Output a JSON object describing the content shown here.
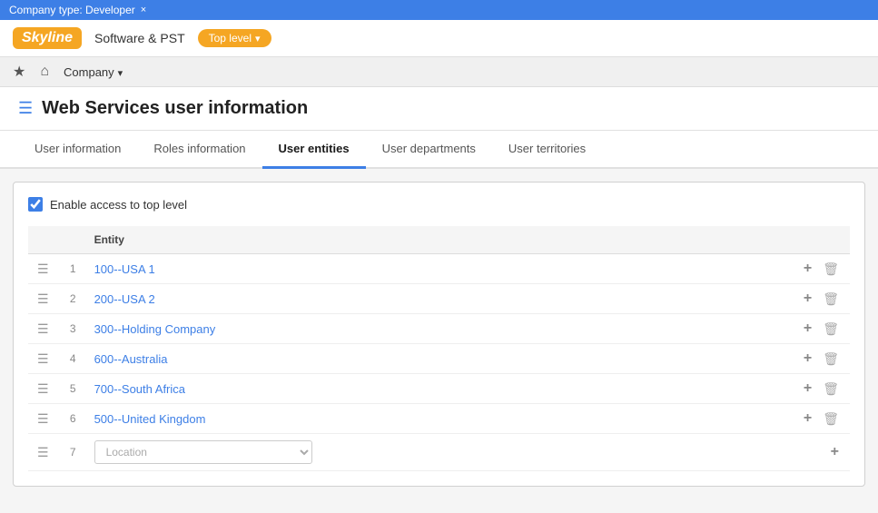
{
  "topBar": {
    "label": "Company type: Developer",
    "closeLabel": "×"
  },
  "header": {
    "logoText": "Skyline",
    "companyName": "Software & PST",
    "topLevelBadge": "Top level"
  },
  "nav": {
    "dropdown": "Company"
  },
  "pageTitle": "Web Services user information",
  "tabs": [
    {
      "id": "user-information",
      "label": "User information",
      "active": false
    },
    {
      "id": "roles-information",
      "label": "Roles information",
      "active": false
    },
    {
      "id": "user-entities",
      "label": "User entities",
      "active": true
    },
    {
      "id": "user-departments",
      "label": "User departments",
      "active": false
    },
    {
      "id": "user-territories",
      "label": "User territories",
      "active": false
    }
  ],
  "enableAccess": {
    "label": "Enable access to top level",
    "checked": true
  },
  "table": {
    "columns": [
      "",
      "",
      "Entity",
      ""
    ],
    "rows": [
      {
        "num": "1",
        "entity": "100--USA 1",
        "isInput": false
      },
      {
        "num": "2",
        "entity": "200--USA 2",
        "isInput": false
      },
      {
        "num": "3",
        "entity": "300--Holding Company",
        "isInput": false
      },
      {
        "num": "4",
        "entity": "600--Australia",
        "isInput": false
      },
      {
        "num": "5",
        "entity": "700--South Africa",
        "isInput": false
      },
      {
        "num": "6",
        "entity": "500--United Kingdom",
        "isInput": false
      },
      {
        "num": "7",
        "entity": "",
        "isInput": true
      }
    ],
    "locationPlaceholder": "Location"
  }
}
